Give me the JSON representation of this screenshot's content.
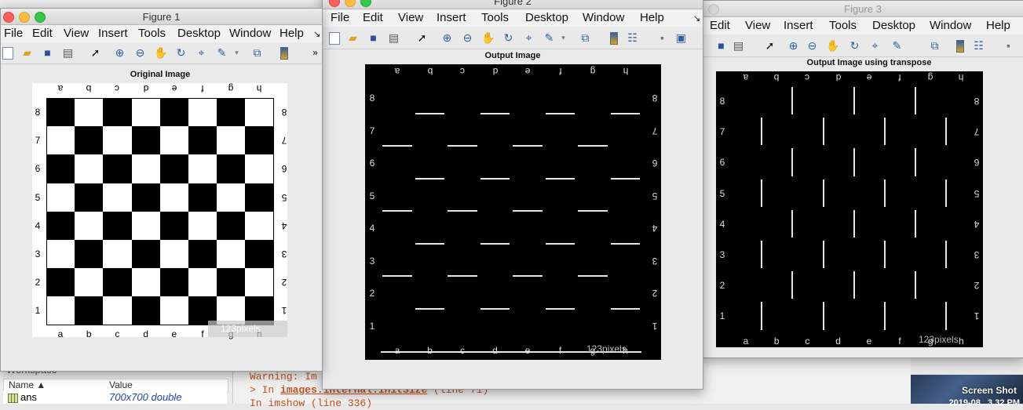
{
  "menus": [
    "File",
    "Edit",
    "View",
    "Insert",
    "Tools",
    "Desktop",
    "Window",
    "Help"
  ],
  "figure1": {
    "title": "Figure 1",
    "axes_title": "Original Image",
    "watermark": "123pixels"
  },
  "figure2": {
    "title": "Figure 2",
    "axes_title": "Output Image",
    "watermark": "123pixels"
  },
  "figure3": {
    "title": "Figure 3",
    "axes_title": "Output Image using transpose",
    "watermark": "123pixels"
  },
  "board": {
    "files": [
      "a",
      "b",
      "c",
      "d",
      "e",
      "f",
      "g",
      "h"
    ],
    "ranks": [
      "8",
      "7",
      "6",
      "5",
      "4",
      "3",
      "2",
      "1"
    ],
    "dark_color": "#000000",
    "light_color": "#ffffff"
  },
  "workspace": {
    "title": "Workspace",
    "col_name": "Name ▲",
    "col_value": "Value",
    "rows": [
      {
        "name": "ans",
        "value": "700x700 double"
      }
    ]
  },
  "console": {
    "line1": "Warning: Im",
    "line2_prefix": "> In ",
    "line2_link": "images.internal.initSize",
    "line2_suffix": " (line 71)",
    "line3": "  In imshow (line 336)"
  },
  "desktop_thumb": {
    "label": "Screen Shot",
    "sublabel": "2019-08...3.32 PM"
  }
}
